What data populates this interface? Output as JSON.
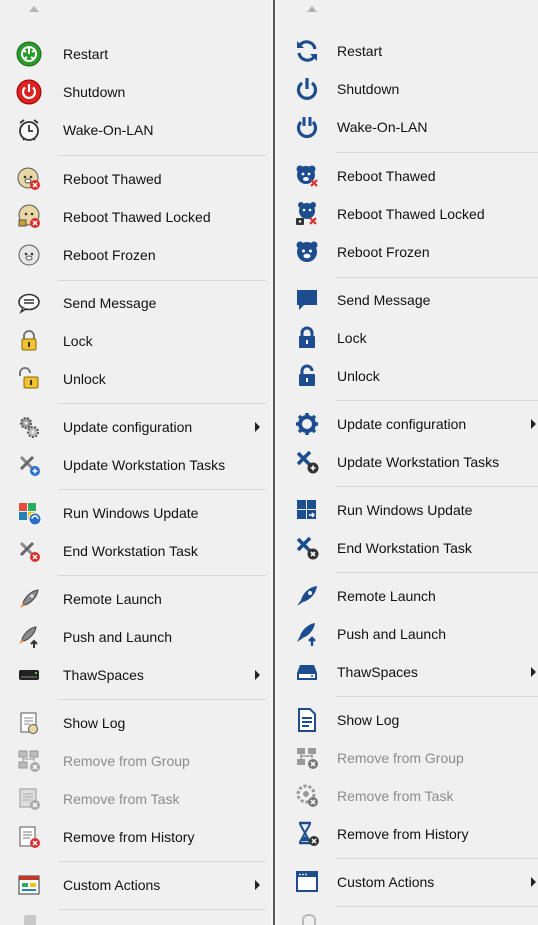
{
  "left_menu": {
    "items": [
      {
        "label": "Restart",
        "icon": "restart-icon",
        "enabled": true
      },
      {
        "label": "Shutdown",
        "icon": "shutdown-icon",
        "enabled": true
      },
      {
        "label": "Wake-On-LAN",
        "icon": "alarm-clock-icon",
        "enabled": true
      },
      {
        "label": "Reboot Thawed",
        "icon": "bear-thawed-icon",
        "enabled": true
      },
      {
        "label": "Reboot Thawed Locked",
        "icon": "bear-thawed-locked-icon",
        "enabled": true
      },
      {
        "label": "Reboot Frozen",
        "icon": "bear-frozen-icon",
        "enabled": true
      },
      {
        "label": "Send Message",
        "icon": "speech-bubble-icon",
        "enabled": true
      },
      {
        "label": "Lock",
        "icon": "padlock-closed-icon",
        "enabled": true
      },
      {
        "label": "Unlock",
        "icon": "padlock-open-icon",
        "enabled": true
      },
      {
        "label": "Update configuration",
        "icon": "gears-icon",
        "enabled": true,
        "submenu": true
      },
      {
        "label": "Update Workstation Tasks",
        "icon": "tools-update-icon",
        "enabled": true
      },
      {
        "label": "Run Windows Update",
        "icon": "windows-update-icon",
        "enabled": true
      },
      {
        "label": "End Workstation Task",
        "icon": "tools-stop-icon",
        "enabled": true
      },
      {
        "label": "Remote Launch",
        "icon": "rocket-icon",
        "enabled": true
      },
      {
        "label": "Push and Launch",
        "icon": "rocket-push-icon",
        "enabled": true
      },
      {
        "label": "ThawSpaces",
        "icon": "drive-icon",
        "enabled": true,
        "submenu": true
      },
      {
        "label": "Show Log",
        "icon": "log-document-icon",
        "enabled": true
      },
      {
        "label": "Remove from Group",
        "icon": "network-remove-icon",
        "enabled": false
      },
      {
        "label": "Remove from Task",
        "icon": "task-remove-icon",
        "enabled": false
      },
      {
        "label": "Remove from History",
        "icon": "history-remove-icon",
        "enabled": true
      },
      {
        "label": "Custom Actions",
        "icon": "custom-actions-icon",
        "enabled": true,
        "submenu": true
      }
    ]
  },
  "right_menu": {
    "items": [
      {
        "label": "Restart",
        "icon": "restart-icon",
        "enabled": true
      },
      {
        "label": "Shutdown",
        "icon": "power-icon",
        "enabled": true
      },
      {
        "label": "Wake-On-LAN",
        "icon": "wake-power-icon",
        "enabled": true
      },
      {
        "label": "Reboot Thawed",
        "icon": "bear-thawed-icon",
        "enabled": true
      },
      {
        "label": "Reboot Thawed Locked",
        "icon": "bear-thawed-locked-icon",
        "enabled": true
      },
      {
        "label": "Reboot Frozen",
        "icon": "bear-frozen-icon",
        "enabled": true
      },
      {
        "label": "Send Message",
        "icon": "chat-bubble-icon",
        "enabled": true
      },
      {
        "label": "Lock",
        "icon": "lock-icon",
        "enabled": true
      },
      {
        "label": "Unlock",
        "icon": "unlock-icon",
        "enabled": true
      },
      {
        "label": "Update configuration",
        "icon": "gear-icon",
        "enabled": true,
        "submenu": true
      },
      {
        "label": "Update Workstation Tasks",
        "icon": "tools-update-icon",
        "enabled": true
      },
      {
        "label": "Run Windows Update",
        "icon": "windows-update-icon",
        "enabled": true
      },
      {
        "label": "End Workstation Task",
        "icon": "tools-stop-icon",
        "enabled": true
      },
      {
        "label": "Remote Launch",
        "icon": "rocket-icon",
        "enabled": true
      },
      {
        "label": "Push and Launch",
        "icon": "rocket-push-icon",
        "enabled": true
      },
      {
        "label": "ThawSpaces",
        "icon": "drive-icon",
        "enabled": true,
        "submenu": true
      },
      {
        "label": "Show Log",
        "icon": "log-document-icon",
        "enabled": true
      },
      {
        "label": "Remove from Group",
        "icon": "network-remove-icon",
        "enabled": false
      },
      {
        "label": "Remove from Task",
        "icon": "task-remove-icon",
        "enabled": false
      },
      {
        "label": "Remove from History",
        "icon": "hourglass-remove-icon",
        "enabled": true
      },
      {
        "label": "Custom Actions",
        "icon": "window-icon",
        "enabled": true,
        "submenu": true
      }
    ]
  },
  "colors": {
    "menu_bg": "#f0f0f0",
    "separator": "#d7d7d7",
    "disabled_text": "#8c8c8c",
    "flat_icon_blue": "#1e4d8f",
    "badge_red": "#d93030"
  }
}
